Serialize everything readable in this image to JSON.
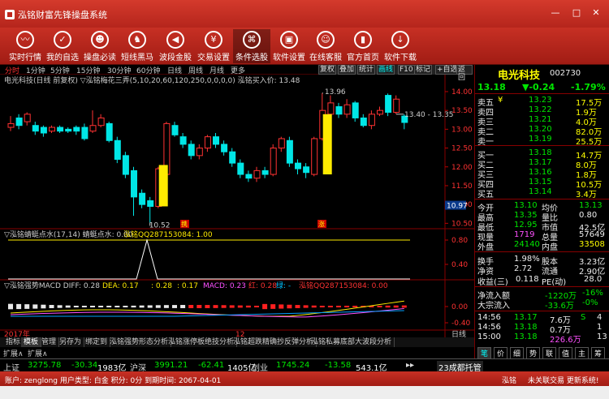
{
  "window": {
    "title": "泓铭财富先锋操盘系统"
  },
  "toolbar": [
    {
      "label": "实时行情",
      "icon": "chart-line-icon"
    },
    {
      "label": "我的自选",
      "icon": "check-circle-icon"
    },
    {
      "label": "操盘必读",
      "icon": "users-icon"
    },
    {
      "label": "短线黑马",
      "icon": "horse-icon"
    },
    {
      "label": "波段金股",
      "icon": "speaker-icon"
    },
    {
      "label": "交易设置",
      "icon": "yen-icon"
    },
    {
      "label": "条件选股",
      "icon": "org-chart-icon"
    },
    {
      "label": "软件设置",
      "icon": "briefcase-icon"
    },
    {
      "label": "在线客服",
      "icon": "people-icon"
    },
    {
      "label": "官方首页",
      "icon": "bar-chart-icon"
    },
    {
      "label": "软件下载",
      "icon": "download-icon"
    }
  ],
  "period_tabs": [
    "分时",
    "1分钟",
    "5分钟",
    "15分钟",
    "30分钟",
    "60分钟",
    "日线",
    "周线",
    "月线",
    "更多"
  ],
  "right_tools": [
    "复权",
    "叠加",
    "统计",
    "画线",
    "F10",
    "标记",
    "+自选",
    "返回"
  ],
  "chart": {
    "main_header": "电光科技(日线 前复权) ▽泓铭梅花三弄(5,10,20,60,120,250,0,0,0,0)  泓铭买入价: 13.48",
    "price_ticks": [
      "14.00",
      "13.50",
      "13.00",
      "12.50",
      "12.00",
      "11.50",
      "11.00",
      "10.50"
    ],
    "current_price_tag": "10.97",
    "high_label": "13.96",
    "low_label": "10.52",
    "range_label": "13.40 - 13.35",
    "mark_buy": "携",
    "mark_sell": "涨",
    "ind1_header": "▽泓铭蜻蜓点水(17,14)  蜻蜓点水: 0.00",
    "ind1_qq": "泓铭QQ287153084: 1.00",
    "ind1_ticks": [
      "0.80",
      "0.40"
    ],
    "ind2_header": "▽泓铭强势MACD  DIFF: 0.28",
    "ind2_dea": "DEA: 0.17",
    "ind2_v1": ": 0.28",
    "ind2_v2": ": 0.17",
    "ind2_macd": "MACD: 0.23",
    "ind2_red": "红: 0.28",
    "ind2_green": "绿: -",
    "ind2_qq": "泓铭QQ287153084: 0.00",
    "ind2_ticks": [
      "0.00",
      "-0.40"
    ],
    "date_left": "2017年",
    "date_mid": "12",
    "date_right": "日线",
    "candles": [
      {
        "o": 13.05,
        "c": 13.15,
        "h": 13.35,
        "l": 12.95
      },
      {
        "o": 13.3,
        "c": 13.1,
        "h": 13.4,
        "l": 13.0
      },
      {
        "o": 13.2,
        "c": 13.4,
        "h": 13.45,
        "l": 13.1
      },
      {
        "o": 13.1,
        "c": 12.95,
        "h": 13.2,
        "l": 12.85
      },
      {
        "o": 13.05,
        "c": 12.9,
        "h": 13.1,
        "l": 12.8
      },
      {
        "o": 12.95,
        "c": 13.05,
        "h": 13.1,
        "l": 12.9
      },
      {
        "o": 13.05,
        "c": 12.95,
        "h": 13.1,
        "l": 12.9
      },
      {
        "o": 13.0,
        "c": 12.95,
        "h": 13.05,
        "l": 12.9
      },
      {
        "o": 13.05,
        "c": 12.95,
        "h": 13.1,
        "l": 12.85
      },
      {
        "o": 13.05,
        "c": 12.75,
        "h": 13.15,
        "l": 12.7
      },
      {
        "o": 12.95,
        "c": 13.1,
        "h": 13.5,
        "l": 12.9
      },
      {
        "o": 13.1,
        "c": 13.3,
        "h": 13.4,
        "l": 13.05
      },
      {
        "o": 13.15,
        "c": 12.7,
        "h": 13.2,
        "l": 12.65
      },
      {
        "o": 12.7,
        "c": 12.2,
        "h": 12.8,
        "l": 12.1
      },
      {
        "o": 12.3,
        "c": 11.8,
        "h": 12.4,
        "l": 11.7
      },
      {
        "o": 11.9,
        "c": 11.2,
        "h": 12.0,
        "l": 10.7
      },
      {
        "o": 11.3,
        "c": 11.0,
        "h": 11.4,
        "l": 10.9
      },
      {
        "o": 11.1,
        "c": 10.95,
        "h": 11.2,
        "l": 10.52
      },
      {
        "o": 10.95,
        "c": 11.95,
        "h": 12.0,
        "l": 10.9
      },
      {
        "o": 11.8,
        "c": 13.15,
        "h": 13.2,
        "l": 11.75
      },
      {
        "o": 13.1,
        "c": 12.85,
        "h": 13.2,
        "l": 12.8
      },
      {
        "o": 12.8,
        "c": 12.6,
        "h": 12.9,
        "l": 12.5
      },
      {
        "o": 12.6,
        "c": 12.3,
        "h": 12.7,
        "l": 12.2
      },
      {
        "o": 12.3,
        "c": 12.5,
        "h": 12.6,
        "l": 12.2
      },
      {
        "o": 12.5,
        "c": 12.8,
        "h": 12.85,
        "l": 12.4
      },
      {
        "o": 12.8,
        "c": 12.6,
        "h": 12.9,
        "l": 12.5
      },
      {
        "o": 12.6,
        "c": 12.4,
        "h": 12.7,
        "l": 12.3
      },
      {
        "o": 12.4,
        "c": 12.1,
        "h": 12.5,
        "l": 12.0
      },
      {
        "o": 12.1,
        "c": 11.8,
        "h": 12.2,
        "l": 11.7
      },
      {
        "o": 11.8,
        "c": 11.7,
        "h": 11.9,
        "l": 11.6
      },
      {
        "o": 11.7,
        "c": 11.9,
        "h": 12.0,
        "l": 11.6
      },
      {
        "o": 11.9,
        "c": 11.8,
        "h": 12.0,
        "l": 11.7
      },
      {
        "o": 11.8,
        "c": 12.5,
        "h": 12.6,
        "l": 11.75
      },
      {
        "o": 12.5,
        "c": 12.75,
        "h": 12.8,
        "l": 12.4
      },
      {
        "o": 12.7,
        "c": 12.1,
        "h": 12.8,
        "l": 12.0
      },
      {
        "o": 12.1,
        "c": 11.95,
        "h": 12.2,
        "l": 11.8
      },
      {
        "o": 12.0,
        "c": 11.85,
        "h": 12.1,
        "l": 11.7
      },
      {
        "o": 11.8,
        "c": 12.75,
        "h": 12.8,
        "l": 11.75
      },
      {
        "o": 12.75,
        "c": 13.5,
        "h": 13.96,
        "l": 12.7
      },
      {
        "o": 13.4,
        "c": 13.7,
        "h": 13.9,
        "l": 13.3
      },
      {
        "o": 13.6,
        "c": 13.4,
        "h": 13.7,
        "l": 13.3
      },
      {
        "o": 13.4,
        "c": 13.65,
        "h": 13.8,
        "l": 13.3
      },
      {
        "o": 13.7,
        "c": 13.3,
        "h": 13.75,
        "l": 13.2
      },
      {
        "o": 13.3,
        "c": 13.1,
        "h": 13.4,
        "l": 13.05
      },
      {
        "o": 13.1,
        "c": 13.4,
        "h": 13.5,
        "l": 13.0
      },
      {
        "o": 13.4,
        "c": 13.5,
        "h": 13.6,
        "l": 13.35
      },
      {
        "o": 13.9,
        "c": 13.45,
        "h": 13.95,
        "l": 13.35
      },
      {
        "o": 13.45,
        "c": 13.8,
        "h": 13.9,
        "l": 13.4
      },
      {
        "o": 13.35,
        "c": 13.18,
        "h": 13.4,
        "l": 13.0
      }
    ],
    "yellow_bars": [
      {
        "i": 17,
        "top": 12.05,
        "bot": 10.95
      },
      {
        "i": 37,
        "top": 13.4,
        "bot": 11.8
      }
    ]
  },
  "info_tabs": [
    "指标",
    "模板",
    "管理",
    "另存为",
    "绑定到",
    "泓铭强势形态分析",
    "泓铭涨停板绝技分析",
    "泓铭超跌精确抄反弹分析",
    "泓铭私募底部大波段分析"
  ],
  "expand_tabs": [
    "扩展∧",
    "扩展∧"
  ],
  "quote": {
    "name": "电光科技",
    "code": "002730",
    "price": "13.18",
    "change": "▼-0.24",
    "pct": "-1.79%",
    "sells": [
      {
        "label": "卖五",
        "flag": "¥",
        "price": "13.23",
        "vol": "17.5万"
      },
      {
        "label": "卖四",
        "price": "13.22",
        "vol": "1.9万"
      },
      {
        "label": "卖三",
        "price": "13.21",
        "vol": "4.0万"
      },
      {
        "label": "卖二",
        "price": "13.20",
        "vol": "82.0万"
      },
      {
        "label": "卖一",
        "price": "13.19",
        "vol": "25.5万"
      }
    ],
    "buys": [
      {
        "label": "买一",
        "price": "13.18",
        "vol": "14.7万"
      },
      {
        "label": "买二",
        "price": "13.17",
        "vol": "8.0万"
      },
      {
        "label": "买三",
        "price": "13.16",
        "vol": "1.8万"
      },
      {
        "label": "买四",
        "price": "13.15",
        "vol": "10.5万"
      },
      {
        "label": "买五",
        "price": "13.14",
        "vol": "3.4万"
      }
    ],
    "stats": [
      {
        "k1": "今开",
        "v1": "13.10",
        "k2": "均价",
        "v2": "13.13"
      },
      {
        "k1": "最高",
        "v1": "13.35",
        "k2": "量比",
        "v2": "0.80"
      },
      {
        "k1": "最低",
        "v1": "12.95",
        "k2": "市值",
        "v2": "42.5亿"
      },
      {
        "k1": "现量",
        "v1": "1719",
        "k2": "总量",
        "v2": "57649"
      },
      {
        "k1": "外盘",
        "v1": "24140",
        "k2": "内盘",
        "v2": "33508"
      }
    ],
    "stats2": [
      {
        "k1": "换手",
        "v1": "1.98%",
        "k2": "股本",
        "v2": "3.23亿"
      },
      {
        "k1": "净资",
        "v1": "2.72",
        "k2": "流通",
        "v2": "2.90亿"
      }
    ],
    "income": {
      "k": "收益(三)",
      "v": "0.118",
      "k2": "PE(动)",
      "v2": "28.0"
    },
    "flow": [
      {
        "k": "净流入额",
        "v": "-1220万",
        "p": "-16%"
      },
      {
        "k": "大宗流入",
        "v": "-33.6万",
        "p": "-0%"
      }
    ],
    "ticks": [
      {
        "t": "14:56",
        "p": "13.17",
        "v": "7.6万",
        "s": "S",
        "n": "4"
      },
      {
        "t": "14:56",
        "p": "13.18",
        "v": "0.7万",
        "s": "",
        "n": "1"
      },
      {
        "t": "15:00",
        "p": "13.18",
        "v": "226.6万",
        "s": "",
        "n": "13"
      }
    ],
    "side_tabs": [
      "笔",
      "价",
      "细",
      "势",
      "联",
      "值",
      "主",
      "筹"
    ]
  },
  "market": [
    {
      "name": "上证",
      "idx": "3275.78",
      "chg": "-30.34",
      "amt": "1983亿"
    },
    {
      "name": "沪深",
      "idx": "3991.21",
      "chg": "-62.41",
      "amt": "1405亿"
    },
    {
      "name": "创业",
      "idx": "1745.24",
      "chg": "-13.58",
      "amt": "543.1亿"
    }
  ],
  "market_extra": "23成都托管",
  "status": {
    "left": "账户: zenglong  用户类型: 白金  积分: 0分  到期时间: 2067-04-01",
    "right1": "泓铭",
    "right2": "未关联交易 更新系统!"
  },
  "colors": {
    "up": "#ff3232",
    "down": "#00e6e6",
    "accent": "#c0281e"
  }
}
